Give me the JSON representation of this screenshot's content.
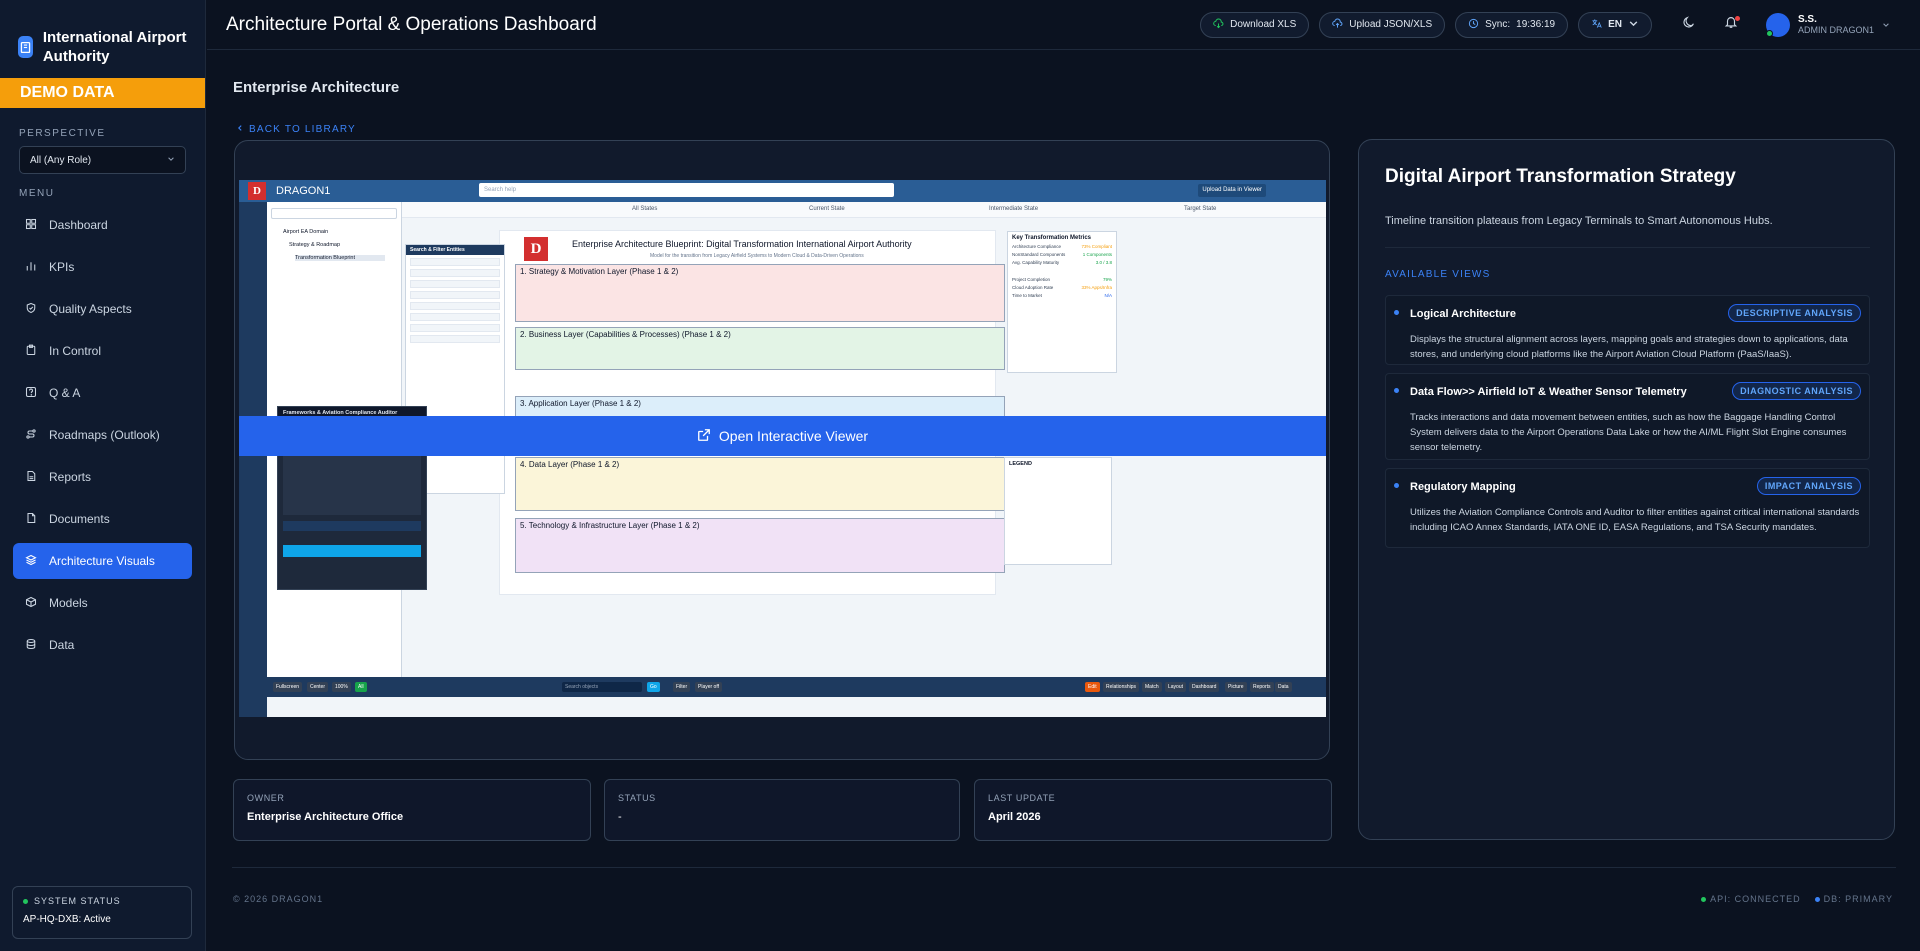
{
  "brand": {
    "name": "International Airport Authority"
  },
  "demo_banner": "DEMO DATA",
  "perspective": {
    "label": "PERSPECTIVE",
    "value": "All (Any Role)"
  },
  "menu": {
    "label": "MENU",
    "items": [
      {
        "label": "Dashboard",
        "icon": "grid-icon",
        "active": false
      },
      {
        "label": "KPIs",
        "icon": "bar-chart-icon",
        "active": false
      },
      {
        "label": "Quality Aspects",
        "icon": "shield-icon",
        "active": false
      },
      {
        "label": "In Control",
        "icon": "clipboard-icon",
        "active": false
      },
      {
        "label": "Q & A",
        "icon": "help-icon",
        "active": false
      },
      {
        "label": "Roadmaps (Outlook)",
        "icon": "route-icon",
        "active": false
      },
      {
        "label": "Reports",
        "icon": "report-icon",
        "active": false
      },
      {
        "label": "Documents",
        "icon": "document-icon",
        "active": false
      },
      {
        "label": "Architecture Visuals",
        "icon": "layers-icon",
        "active": true
      },
      {
        "label": "Models",
        "icon": "cube-icon",
        "active": false
      },
      {
        "label": "Data",
        "icon": "database-icon",
        "active": false
      }
    ]
  },
  "system_status": {
    "label": "SYSTEM STATUS",
    "value": "AP-HQ-DXB: Active",
    "color": "#22c55e"
  },
  "header": {
    "title": "Architecture Portal & Operations Dashboard",
    "download": "Download XLS",
    "upload": "Upload JSON/XLS",
    "sync_label": "Sync:",
    "sync_time": "19:36:19",
    "lang": "EN",
    "user_initials": "S.S.",
    "user_role": "ADMIN DRAGON1"
  },
  "page": {
    "title": "Enterprise Architecture",
    "back": "BACK TO LIBRARY"
  },
  "viewer": {
    "open_label": "Open Interactive Viewer",
    "app_name": "DRAGON1",
    "search_placeholder": "Search help",
    "upload_btn": "Upload Data in Viewer",
    "states": [
      "All States",
      "Current State",
      "Intermediate State",
      "Target State"
    ],
    "tree_root": "Airport EA Domain",
    "tree_folder": "Strategy & Roadmap",
    "tree_item": "Transformation Blueprint",
    "filter_title": "Search & Filter Entities",
    "compliance_title": "Frameworks & Aviation Compliance Auditor",
    "blueprint_title": "Enterprise Architecture Blueprint: Digital Transformation International Airport Authority",
    "blueprint_sub": "Model for the transition from Legacy Airfield Systems to Modern Cloud & Data-Driven Operations",
    "layers": [
      "1. Strategy & Motivation Layer (Phase 1 & 2)",
      "2. Business Layer (Capabilities & Processes) (Phase 1 & 2)",
      "3. Application Layer (Phase 1 & 2)",
      "4. Data Layer (Phase 1 & 2)",
      "5. Technology & Infrastructure Layer (Phase 1 & 2)"
    ],
    "metrics_title": "Key Transformation Metrics",
    "metrics": [
      {
        "k": "Architecture Compliance",
        "v": "73% Compliant"
      },
      {
        "k": "NonStandard Components",
        "v": "1 Components"
      },
      {
        "k": "Avg. Capability Maturity",
        "v": "3.0 / 3.8"
      },
      {
        "k": "Project Completion",
        "v": "79%"
      },
      {
        "k": "Cloud Adoption Rate",
        "v": "33% Apps/Infra"
      },
      {
        "k": "Time to Market",
        "v": "N/A"
      }
    ],
    "legend_title": "LEGEND",
    "bottom_buttons": [
      "Fullscreen",
      "Center",
      "100%",
      "All",
      "Go",
      "Filter",
      "Player off",
      "Edit",
      "Relationships",
      "Match",
      "Layout",
      "Dashboard",
      "Picture",
      "Reports",
      "Data"
    ],
    "bottom_search": "Search objects"
  },
  "info": [
    {
      "label": "OWNER",
      "value": "Enterprise Architecture Office"
    },
    {
      "label": "STATUS",
      "value": "-"
    },
    {
      "label": "LAST UPDATE",
      "value": "April 2026"
    }
  ],
  "panel": {
    "title": "Digital Airport Transformation Strategy",
    "subtitle": "Timeline transition plateaus from Legacy Terminals to Smart Autonomous Hubs.",
    "views_label": "AVAILABLE VIEWS",
    "views": [
      {
        "title": "Logical Architecture",
        "tag": "DESCRIPTIVE ANALYSIS",
        "desc": "Displays the structural alignment across layers, mapping goals and strategies down to applications, data stores, and underlying cloud platforms like the Airport Aviation Cloud Platform (PaaS/IaaS)."
      },
      {
        "title": "Data Flow>> Airfield IoT & Weather Sensor Telemetry",
        "tag": "DIAGNOSTIC ANALYSIS",
        "desc": "Tracks interactions and data movement between entities, such as how the Baggage Handling Control System delivers data to the Airport Operations Data Lake or how the AI/ML Flight Slot Engine consumes sensor telemetry."
      },
      {
        "title": "Regulatory Mapping",
        "tag": "IMPACT ANALYSIS",
        "desc": "Utilizes the Aviation Compliance Controls and Auditor to filter entities against critical international standards including ICAO Annex Standards, IATA ONE ID, EASA Regulations, and TSA Security mandates."
      }
    ]
  },
  "footer": {
    "copyright": "© 2026 DRAGON1",
    "api": "API: CONNECTED",
    "db": "DB: PRIMARY"
  },
  "colors": {
    "accent": "#2563eb",
    "demo": "#f59e0b",
    "ok": "#22c55e"
  }
}
